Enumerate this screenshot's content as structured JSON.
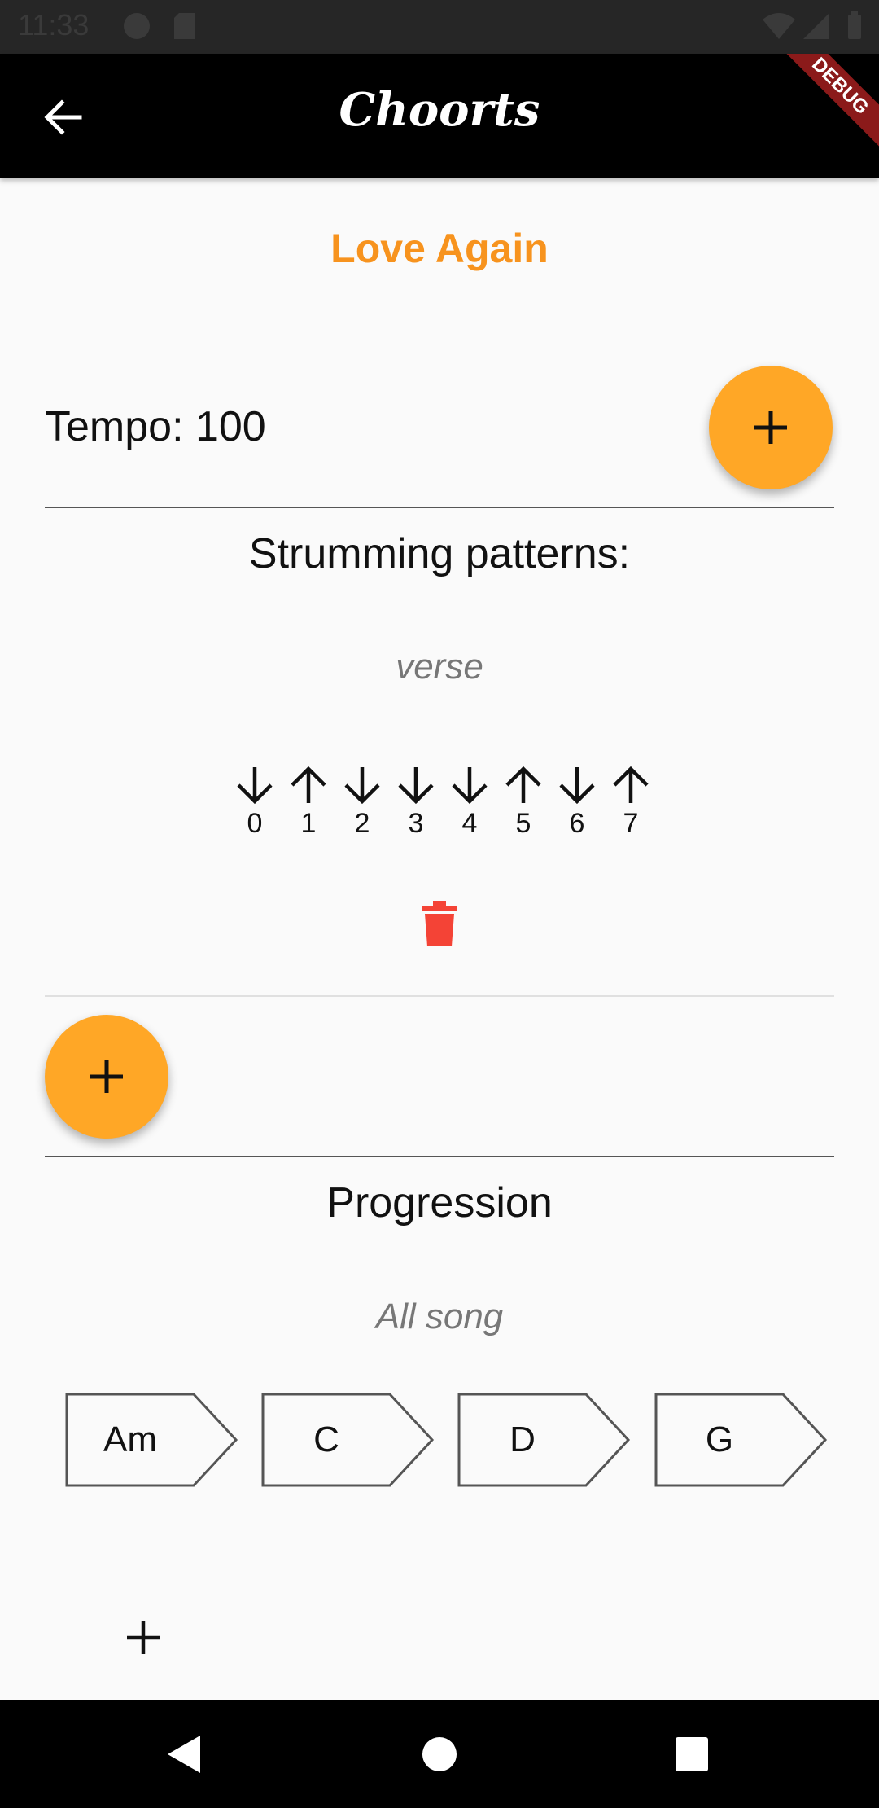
{
  "status_bar": {
    "time": "11:33"
  },
  "app_bar": {
    "title": "Choorts",
    "debug_label": "DEBUG"
  },
  "song": {
    "title": "Love Again"
  },
  "tempo": {
    "label": "Tempo: 100"
  },
  "strumming": {
    "heading": "Strumming patterns:",
    "patterns": [
      {
        "name": "verse",
        "strums": [
          {
            "index": "0",
            "direction": "down"
          },
          {
            "index": "1",
            "direction": "up"
          },
          {
            "index": "2",
            "direction": "down"
          },
          {
            "index": "3",
            "direction": "down"
          },
          {
            "index": "4",
            "direction": "down"
          },
          {
            "index": "5",
            "direction": "up"
          },
          {
            "index": "6",
            "direction": "down"
          },
          {
            "index": "7",
            "direction": "up"
          }
        ]
      }
    ]
  },
  "progression": {
    "heading": "Progression",
    "name": "All song",
    "chords": [
      "Am",
      "C",
      "D",
      "G"
    ]
  },
  "colors": {
    "accent": "#ffa726",
    "song_title": "#f7931e",
    "delete": "#f44336",
    "app_bar": "#000000"
  },
  "icons": [
    "back-arrow-icon",
    "plus-icon",
    "arrow-down-icon",
    "arrow-up-icon",
    "trash-icon",
    "nav-back-icon",
    "nav-home-icon",
    "nav-recents-icon"
  ]
}
